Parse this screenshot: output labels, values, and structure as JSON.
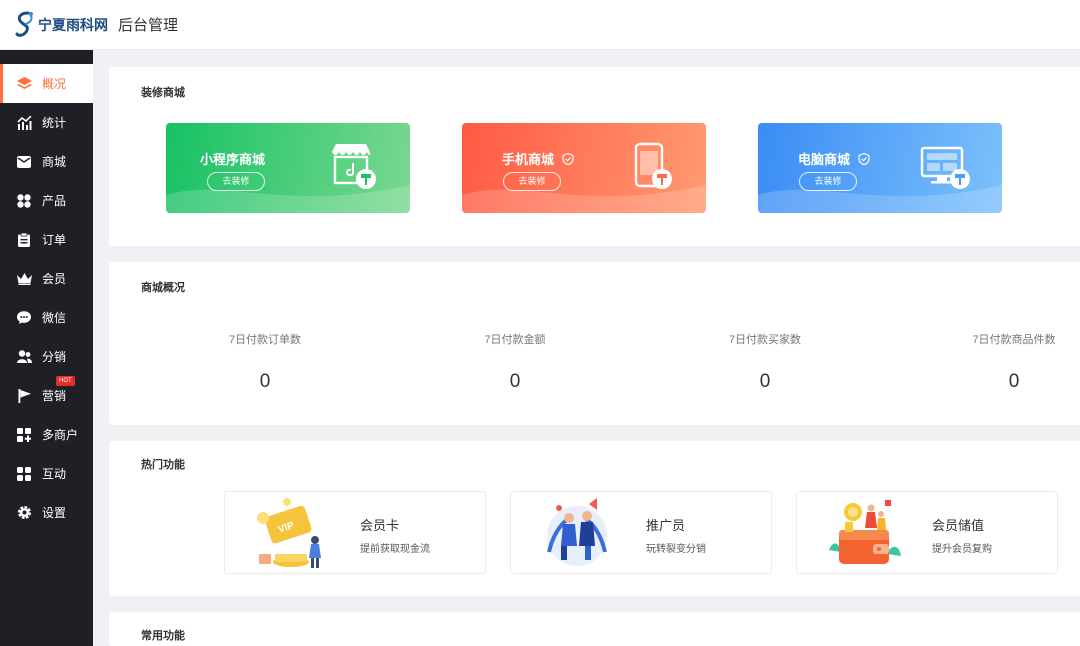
{
  "header": {
    "logo_text": "宁夏雨科网",
    "admin_title": "后台管理"
  },
  "sidebar": {
    "items": [
      {
        "label": "概况",
        "icon": "layers-icon",
        "active": true
      },
      {
        "label": "统计",
        "icon": "bar-chart-icon"
      },
      {
        "label": "商城",
        "icon": "mail-icon"
      },
      {
        "label": "产品",
        "icon": "clover-icon"
      },
      {
        "label": "订单",
        "icon": "clipboard-icon"
      },
      {
        "label": "会员",
        "icon": "crown-icon"
      },
      {
        "label": "微信",
        "icon": "chat-icon"
      },
      {
        "label": "分销",
        "icon": "users-icon"
      },
      {
        "label": "营销",
        "icon": "flag-icon",
        "badge": "HOT"
      },
      {
        "label": "多商户",
        "icon": "store-grid-icon"
      },
      {
        "label": "互动",
        "icon": "grid-icon"
      },
      {
        "label": "设置",
        "icon": "gear-icon"
      }
    ]
  },
  "decorate": {
    "title": "装修商城",
    "tiles": [
      {
        "label": "小程序商城",
        "button": "去装修",
        "color_from": "#17c165",
        "color_to": "#7ad88f",
        "verified": false
      },
      {
        "label": "手机商城",
        "button": "去装修",
        "color_from": "#ff5a43",
        "color_to": "#ff9a72",
        "verified": true
      },
      {
        "label": "电脑商城",
        "button": "去装修",
        "color_from": "#3a8cf5",
        "color_to": "#7cc1fb",
        "verified": true
      }
    ]
  },
  "overview": {
    "title": "商城概况",
    "stats": [
      {
        "label": "7日付款订单数",
        "value": "0"
      },
      {
        "label": "7日付款金额",
        "value": "0"
      },
      {
        "label": "7日付款买家数",
        "value": "0"
      },
      {
        "label": "7日付款商品件数",
        "value": "0"
      }
    ]
  },
  "hot": {
    "title": "热门功能",
    "features": [
      {
        "name": "会员卡",
        "desc": "提前获取现金流"
      },
      {
        "name": "推广员",
        "desc": "玩转裂变分销"
      },
      {
        "name": "会员储值",
        "desc": "提升会员复购"
      }
    ]
  },
  "common": {
    "title": "常用功能"
  },
  "colors": {
    "accent": "#ff6f36",
    "sidebar_bg": "#1f2026",
    "hot_badge": "#e52b2b"
  }
}
